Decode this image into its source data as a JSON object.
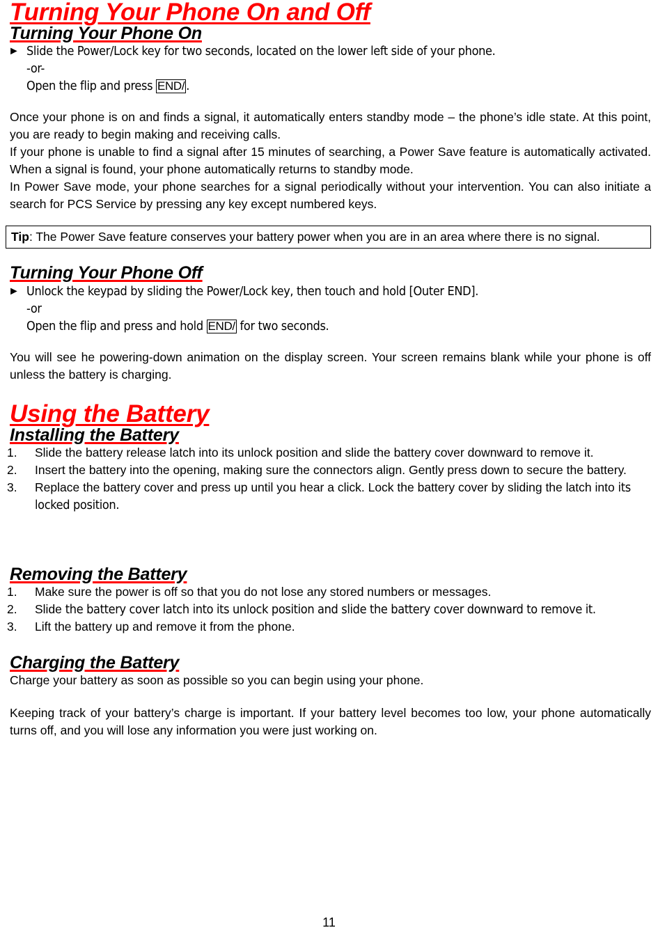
{
  "document": {
    "page_number": "11",
    "accent_color": "#FF0000",
    "text_color": "#000000",
    "background_color": "#FFFFFF"
  },
  "section_phone_on_off": {
    "title": "Turning Your Phone On and Off",
    "sub_on": {
      "heading": "Turning Your Phone On",
      "bullet_marker": "►",
      "line1": "Slide the Power/Lock key for two seconds, located on the lower left side of your phone.",
      "line2": "-or-",
      "line3_prefix": "Open the flip and press ",
      "line3_key": "END/",
      "line3_suffix": "."
    },
    "paragraph1": "Once your phone is on and finds a signal, it automatically enters standby mode – the phone’s idle state. At this point, you are ready to begin making and receiving calls.",
    "paragraph2": "If your phone is unable to find a signal after 15 minutes of searching, a Power Save feature is automatically activated. When a signal is found, your phone automatically returns to standby mode.",
    "paragraph3": "In Power Save mode, your phone searches for a signal periodically without your intervention. You can also initiate a search for PCS Service by pressing any key except numbered keys.",
    "tip": {
      "label": "Tip",
      "text": ": The Power Save feature conserves your battery power when you are in an area where there is no signal."
    },
    "sub_off": {
      "heading": "Turning Your Phone Off",
      "bullet_marker": "►",
      "line1": "Unlock the keypad by sliding the Power/Lock key, then touch and hold [Outer END].",
      "line2": "-or",
      "line3_prefix": "Open the flip and press and hold ",
      "line3_key": "END/",
      "line3_suffix": " for two seconds."
    },
    "paragraph4": "You will see he powering-down animation on the display screen. Your screen remains blank while your phone is off unless the battery is charging."
  },
  "section_using_battery": {
    "title": "Using the Battery",
    "installing": {
      "heading": "Installing the Battery",
      "items": [
        {
          "number": "1.",
          "text": "Slide the battery release latch into its unlock position and slide the battery cover downward to remove it."
        },
        {
          "number": "2.",
          "text": "Insert the battery into the opening, making sure the connectors align. Gently press down to secure the battery."
        },
        {
          "number": "3.",
          "text_part1": "Replace the battery cover and press up until you hear a click. Lock the battery cover by sliding the latch into ",
          "text_part2": "its locked position."
        }
      ]
    },
    "removing": {
      "heading": "Removing the Battery",
      "items": [
        {
          "number": "1.",
          "text": "Make sure the power is off so that you do not lose any stored numbers or messages."
        },
        {
          "number": "2.",
          "text_part1": "Slide ",
          "text_part2": "the battery cover latch into its unlock position and slide the battery cover downward to remove it."
        },
        {
          "number": "3.",
          "text": "Lift the battery up and remove it from the phone."
        }
      ]
    },
    "charging": {
      "heading": "Charging the Battery",
      "paragraph1": "Charge your battery as soon as possible so you can begin using your phone.",
      "paragraph2": "Keeping track of your battery’s charge is important. If your battery level becomes too low, your phone automatically turns off, and you will lose any information you were just working on."
    }
  }
}
